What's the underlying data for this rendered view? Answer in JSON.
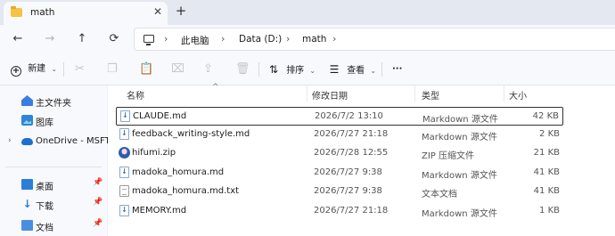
{
  "tab": {
    "title": "math",
    "close_glyph": "✕",
    "new_tab_glyph": "+"
  },
  "nav": {
    "back": "←",
    "forward": "→",
    "up": "↑",
    "refresh": "⟳"
  },
  "breadcrumb": [
    "此电脑",
    "Data (D:)",
    "math"
  ],
  "breadcrumb_sep": "›",
  "toolbar": {
    "new_label": "新建",
    "sort_label": "排序",
    "view_label": "查看",
    "more": "···",
    "caret": "⌄"
  },
  "sidebar": {
    "items": [
      {
        "label": "主文件夹",
        "icon": "home-icon"
      },
      {
        "label": "图库",
        "icon": "gallery-icon"
      },
      {
        "label": "OneDrive - MSFT",
        "icon": "cloud-icon",
        "expand": "›"
      },
      {
        "label": "桌面",
        "icon": "desktop-icon",
        "pin": "📌"
      },
      {
        "label": "下载",
        "icon": "download-icon",
        "pin": "📌"
      },
      {
        "label": "文档",
        "icon": "documents-icon",
        "pin": "📌"
      }
    ]
  },
  "columns": {
    "name": "名称",
    "date": "修改日期",
    "type": "类型",
    "size": "大小",
    "sort_caret": "^"
  },
  "files": [
    {
      "name": "CLAUDE.md",
      "date": "2026/7/2 13:10",
      "type": "Markdown 源文件",
      "size": "42 KB",
      "kind": "md"
    },
    {
      "name": "feedback_writing-style.md",
      "date": "2026/7/27 21:18",
      "type": "Markdown 源文件",
      "size": "2 KB",
      "kind": "md"
    },
    {
      "name": "hifumi.zip",
      "date": "2026/7/28 12:55",
      "type": "ZIP 压缩文件",
      "size": "21 KB",
      "kind": "zip"
    },
    {
      "name": "madoka_homura.md",
      "date": "2026/7/27 9:38",
      "type": "Markdown 源文件",
      "size": "41 KB",
      "kind": "md"
    },
    {
      "name": "madoka_homura.md.txt",
      "date": "2026/7/27 9:38",
      "type": "文本文档",
      "size": "41 KB",
      "kind": "txt"
    },
    {
      "name": "MEMORY.md",
      "date": "2026/7/27 21:18",
      "type": "Markdown 源文件",
      "size": "1 KB",
      "kind": "md"
    }
  ]
}
